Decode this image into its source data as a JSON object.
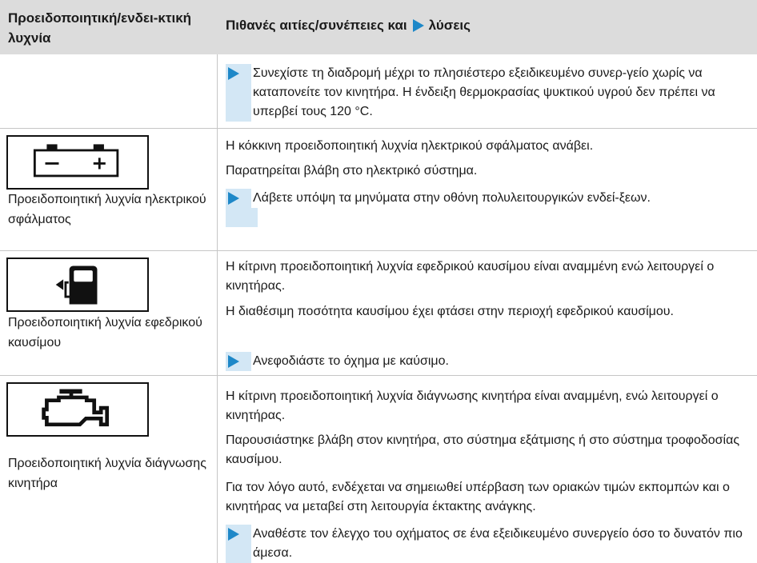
{
  "header": {
    "col1": "Προειδοποιητική/ενδει-κτική λυχνία",
    "col2_before": "Πιθανές αιτίες/συνέπειες και",
    "col2_after": "λύσεις"
  },
  "row0": {
    "step": "Συνεχίστε τη διαδρομή μέχρι το πλησιέστερο εξειδικευμένο συνερ-γείο χωρίς να καταπονείτε τον κινητήρα. Η ένδειξη θερμοκρασίας ψυκτικού υγρού δεν πρέπει να υπερβεί τους 120 °C."
  },
  "row1": {
    "icon": "battery-icon",
    "label": "Προειδοποιητική λυχνία ηλεκτρικού σφάλματος",
    "p1": "Η κόκκινη προειδοποιητική λυχνία ηλεκτρικού σφάλματος ανάβει.",
    "p2": "Παρατηρείται βλάβη στο ηλεκτρικό σύστημα.",
    "step": "Λάβετε υπόψη τα μηνύματα στην οθόνη πολυλειτουργικών ενδεί-ξεων."
  },
  "row2": {
    "icon": "fuel-pump-icon",
    "label": "Προειδοποιητική λυχνία εφεδρικού καυσίμου",
    "p1": "Η κίτρινη προειδοποιητική λυχνία εφεδρικού καυσίμου είναι αναμμένη ενώ λειτουργεί ο κινητήρας.",
    "p2": "Η διαθέσιμη ποσότητα καυσίμου έχει φτάσει στην περιοχή εφεδρικού καυσίμου.",
    "step": "Ανεφοδιάστε το όχημα με καύσιμο."
  },
  "row3": {
    "icon": "engine-icon",
    "label": "Προειδοποιητική λυχνία διάγνωσης κινητήρα",
    "p1": "Η κίτρινη προειδοποιητική λυχνία διάγνωσης κινητήρα είναι αναμμένη, ενώ λειτουργεί ο κινητήρας.",
    "p2": "Παρουσιάστηκε βλάβη στον κινητήρα, στο σύστημα εξάτμισης ή στο σύστημα τροφοδοσίας καυσίμου.",
    "p3": "Για τον λόγο αυτό, ενδέχεται να σημειωθεί υπέρβαση των οριακών τιμών εκπομπών και ο κινητήρας να μεταβεί στη λειτουργία έκτακτης ανάγκης.",
    "step": "Αναθέστε τον έλεγχο του οχήματος σε ένα εξειδικευμένο συνεργείο όσο το δυνατόν πιο άμεσα."
  },
  "colors": {
    "header_bg": "#dcdcdc",
    "accent": "#1e88c8",
    "step_bar": "#d3e7f5"
  }
}
